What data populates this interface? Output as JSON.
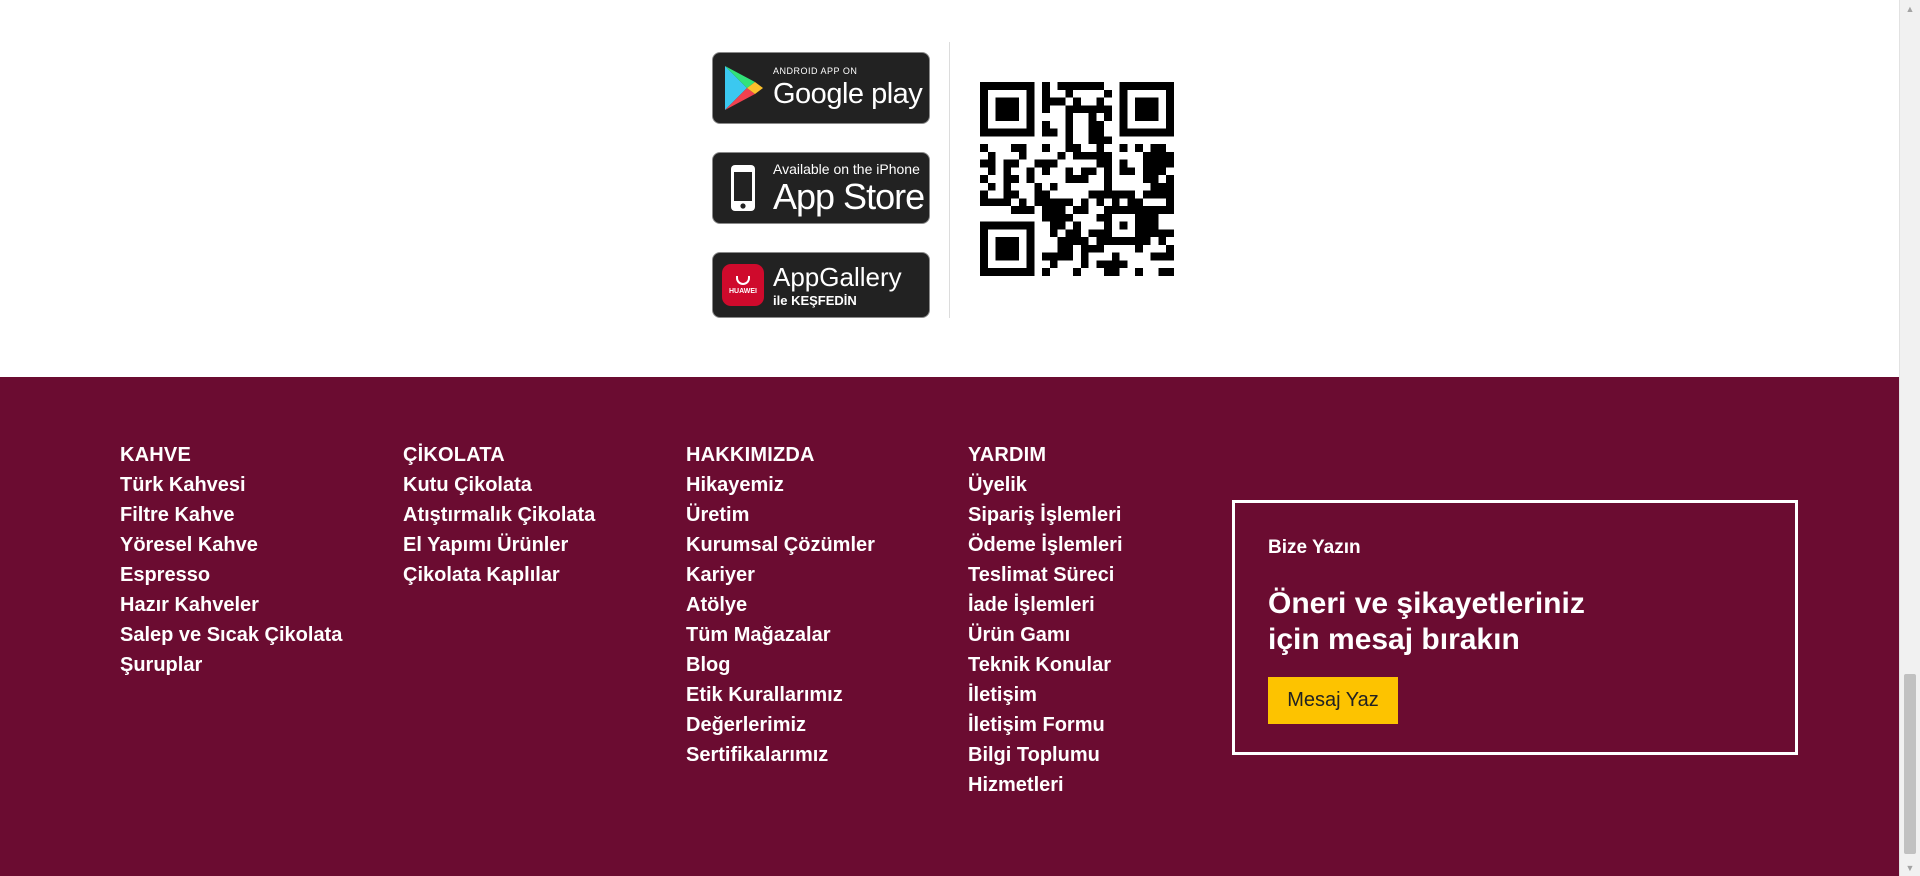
{
  "apps": {
    "google_play": {
      "small": "ANDROID APP ON",
      "big": "Google play"
    },
    "app_store": {
      "small": "Available on the iPhone",
      "big": "App Store"
    },
    "app_gallery": {
      "big": "AppGallery",
      "small": "ile KEŞFEDİN",
      "brand": "HUAWEI"
    }
  },
  "footer": {
    "columns": [
      {
        "title": "KAHVE",
        "items": [
          "Türk Kahvesi",
          "Filtre Kahve",
          "Yöresel Kahve",
          "Espresso",
          "Hazır Kahveler",
          "Salep ve Sıcak Çikolata",
          "Şuruplar"
        ]
      },
      {
        "title": "ÇİKOLATA",
        "items": [
          "Kutu Çikolata",
          "Atıştırmalık Çikolata",
          "El Yapımı Ürünler",
          "Çikolata Kaplılar"
        ]
      },
      {
        "title": "HAKKIMIZDA",
        "items": [
          "Hikayemiz",
          "Üretim",
          "Kurumsal Çözümler",
          "Kariyer",
          "Atölye",
          "Tüm Mağazalar",
          "Blog",
          "Etik Kurallarımız",
          "Değerlerimiz",
          "Sertifikalarımız"
        ]
      },
      {
        "title": "YARDIM",
        "items": [
          "Üyelik",
          "Sipariş İşlemleri",
          "Ödeme İşlemleri",
          "Teslimat Süreci",
          "İade İşlemleri",
          "Ürün Gamı",
          "Teknik Konular",
          "İletişim",
          "İletişim Formu",
          "Bilgi Toplumu",
          "Hizmetleri"
        ]
      }
    ],
    "contact": {
      "kicker": "Bize Yazın",
      "heading_line1": "Öneri ve şikayetleriniz",
      "heading_line2": "için mesaj bırakın",
      "button": "Mesaj Yaz"
    }
  },
  "colors": {
    "footer_bg": "#6b0c31",
    "button_bg": "#fdc300",
    "badge_bg": "#222222",
    "huawei_red": "#cf0a2c"
  }
}
